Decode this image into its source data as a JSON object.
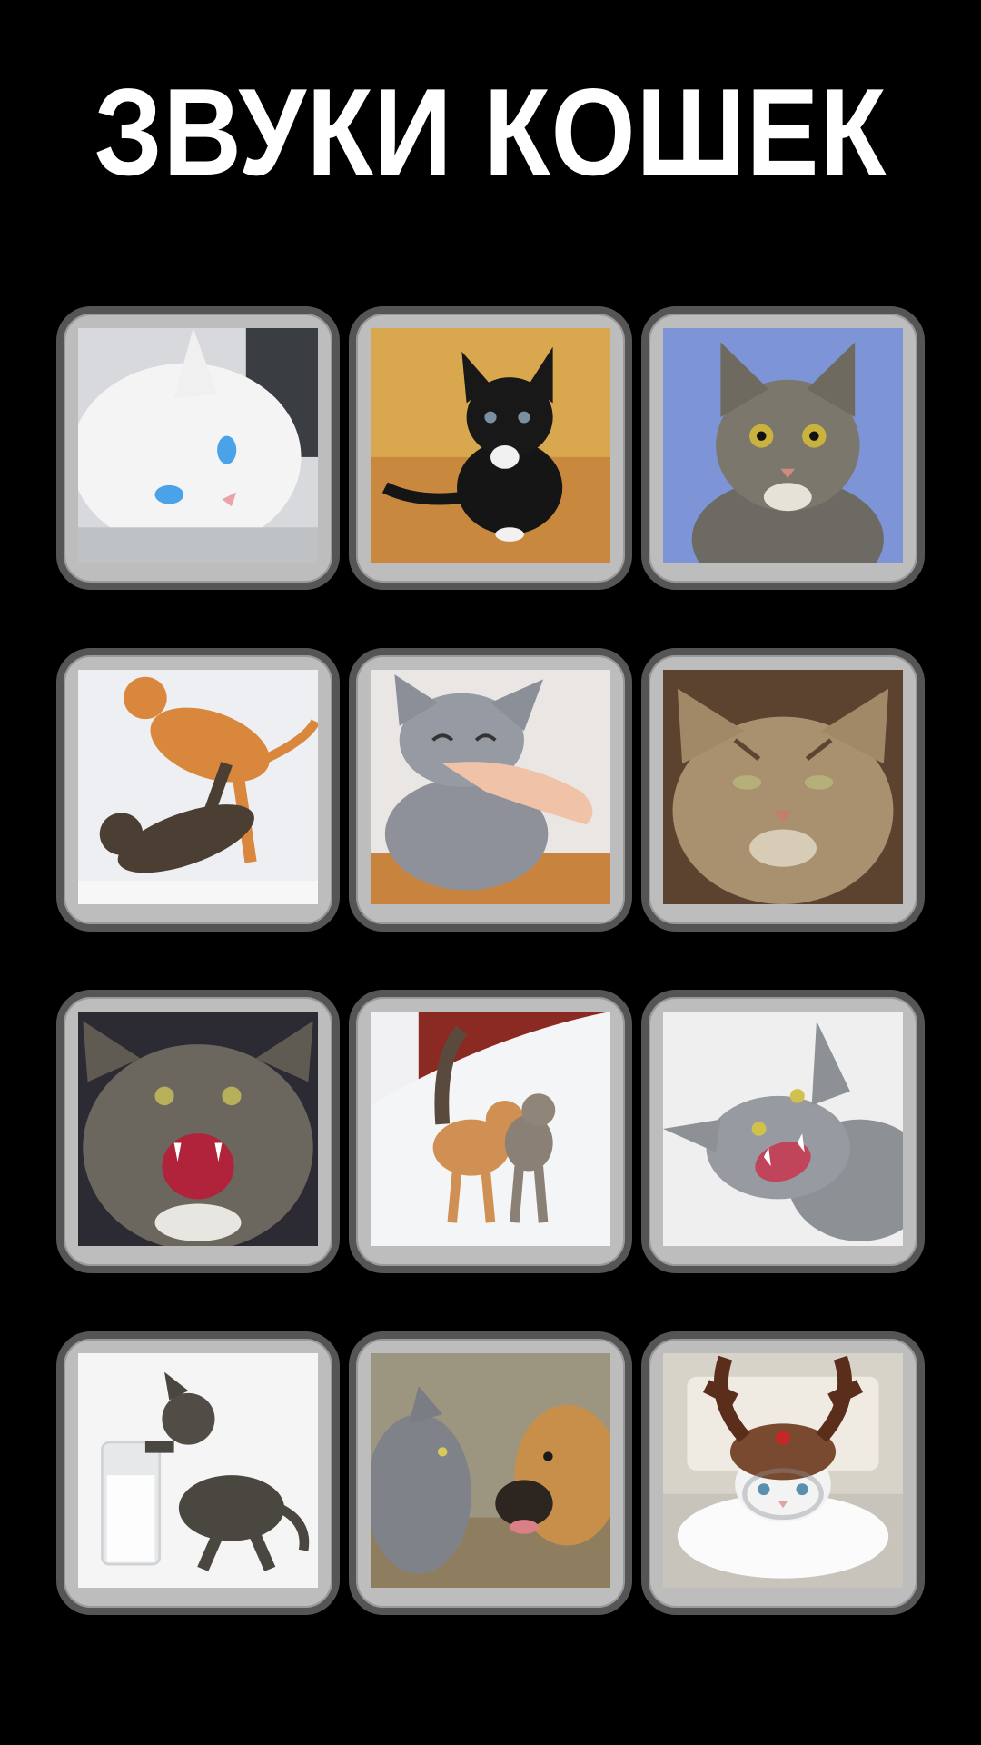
{
  "header": {
    "title": "ЗВУКИ КОШЕК"
  },
  "sound_buttons": [
    {
      "icon": "white-blue-eyed-cat-photo",
      "accent": "#f2f2f2"
    },
    {
      "icon": "black-kitten-photo",
      "accent": "#1a1a1a"
    },
    {
      "icon": "tabby-cat-portrait-photo",
      "accent": "#6e86c9"
    },
    {
      "icon": "fighting-cats-photo",
      "accent": "#d9833a"
    },
    {
      "icon": "purring-gray-cat-photo",
      "accent": "#8b8f98"
    },
    {
      "icon": "grumpy-tabby-cat-photo",
      "accent": "#9a7a55"
    },
    {
      "icon": "hissing-tabby-cat-photo",
      "accent": "#5b5a55"
    },
    {
      "icon": "cats-in-snow-photo",
      "accent": "#e8e8ea"
    },
    {
      "icon": "angry-gray-cat-photo",
      "accent": "#9a9ca0"
    },
    {
      "icon": "kitten-milk-glass-photo",
      "accent": "#f5f5f5"
    },
    {
      "icon": "cat-and-dog-photo",
      "accent": "#c98a45"
    },
    {
      "icon": "cat-reindeer-hat-photo",
      "accent": "#6b3a22"
    }
  ]
}
